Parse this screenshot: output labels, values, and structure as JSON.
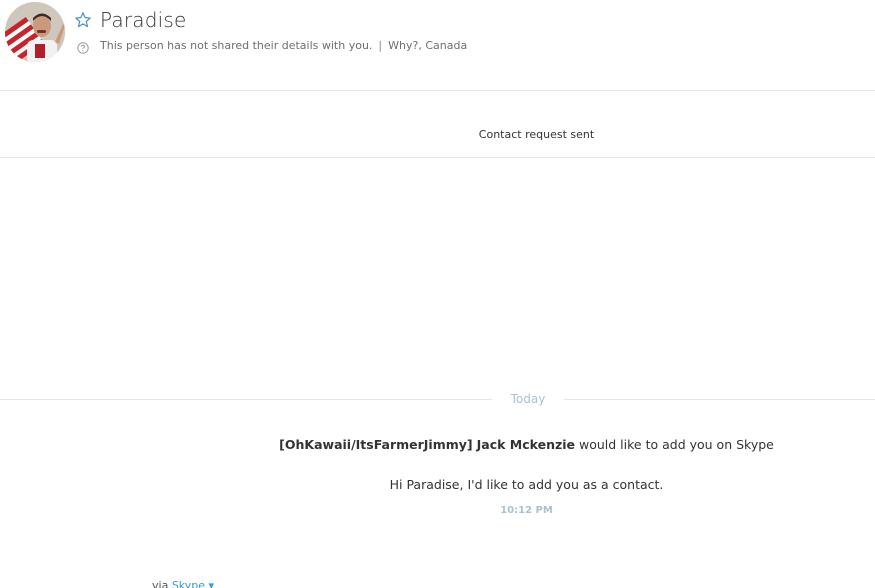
{
  "header": {
    "contact_name": "Paradise",
    "details_text": "This person has not shared their details with you.",
    "separator": "|",
    "location": "Why?, Canada",
    "icons": {
      "favorite": "star-outline-icon",
      "help": "question-circle-icon"
    }
  },
  "status": {
    "request_sent": "Contact request sent"
  },
  "conversation": {
    "day_label": "Today",
    "request": {
      "sender_tag": "[OhKawaii/ItsFarmerJimmy]",
      "sender_name": "Jack Mckenzie",
      "action_text": "would like to add you on Skype"
    },
    "greeting": "Hi Paradise, I'd like to add you as a contact.",
    "time": "10:12 PM"
  },
  "footer": {
    "via_prefix": "via",
    "via_link": "Skype",
    "via_arrow": "▾"
  },
  "colors": {
    "accent": "#2d9ee0",
    "muted_blue": "#a9c3d3",
    "rule": "#e6e6e6",
    "text": "#333333"
  }
}
